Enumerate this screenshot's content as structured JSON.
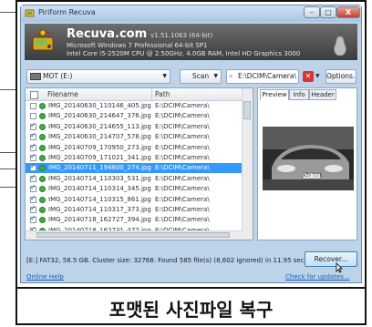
{
  "window": {
    "title": "Piriform Recuva",
    "buttons": {
      "minimize": "–",
      "maximize": "□",
      "close": "X"
    }
  },
  "banner": {
    "brand": "Recuva.com",
    "version": "v1.51.1063 (64-bit)",
    "sysinfo_line1": "Microsoft Windows 7 Professional 64-bit SP1",
    "sysinfo_line2": "Intel Core i5-2520M CPU @ 2.50GHz, 4.0GB RAM, Intel HD Graphics 3000"
  },
  "toolbar": {
    "drive_select": "MOT (E:)",
    "scan_button": "Scan",
    "path_input": "E:\\DCIM\\Camera\\",
    "options_button": "Options..."
  },
  "list": {
    "col_filename": "Filename",
    "col_path": "Path",
    "rows": [
      {
        "name": "IMG_20140630_110146_405.jpg",
        "path": "E:\\DCIM\\Camera\\",
        "checked": false,
        "selected": false
      },
      {
        "name": "IMG_20140630_214647_376.jpg",
        "path": "E:\\DCIM\\Camera\\",
        "checked": false,
        "selected": false
      },
      {
        "name": "IMG_20140630_214655_113.jpg",
        "path": "E:\\DCIM\\Camera\\",
        "checked": true,
        "selected": false
      },
      {
        "name": "IMG_20140630_214707_578.jpg",
        "path": "E:\\DCIM\\Camera\\",
        "checked": true,
        "selected": false
      },
      {
        "name": "IMG_20140709_170950_273.jpg",
        "path": "E:\\DCIM\\Camera\\",
        "checked": true,
        "selected": false
      },
      {
        "name": "IMG_20140709_171021_341.jpg",
        "path": "E:\\DCIM\\Camera\\",
        "checked": true,
        "selected": false
      },
      {
        "name": "IMG_20140711_194800_274.jpg",
        "path": "E:\\DCIM\\Camera\\",
        "checked": true,
        "selected": true
      },
      {
        "name": "IMG_20140714_110303_531.jpg",
        "path": "E:\\DCIM\\Camera\\",
        "checked": true,
        "selected": false
      },
      {
        "name": "IMG_20140714_110314_345.jpg",
        "path": "E:\\DCIM\\Camera\\",
        "checked": true,
        "selected": false
      },
      {
        "name": "IMG_20140714_110315_861.jpg",
        "path": "E:\\DCIM\\Camera\\",
        "checked": true,
        "selected": false
      },
      {
        "name": "IMG_20140714_110317_373.jpg",
        "path": "E:\\DCIM\\Camera\\",
        "checked": true,
        "selected": false
      },
      {
        "name": "IMG_20140718_162727_394.jpg",
        "path": "E:\\DCIM\\Camera\\",
        "checked": true,
        "selected": false
      },
      {
        "name": "IMG_20140718_162731_477.jpg",
        "path": "E:\\DCIM\\Camera\\",
        "checked": true,
        "selected": false
      }
    ]
  },
  "preview": {
    "tabs": [
      "Preview",
      "Info",
      "Header"
    ],
    "active_tab": 0,
    "plate_text": "KZV 7171"
  },
  "status": {
    "text": "[E:] FAT32, 58.5 GB. Cluster size: 32768. Found 585 file(s) (8,602 ignored) in 11.95 sec.",
    "recover_button": "Recover..."
  },
  "footer": {
    "online_help": "Online Help",
    "check_updates": "Check for updates..."
  },
  "caption": {
    "text": "포맷된 사진파일 복구"
  },
  "colors": {
    "selection": "#3399ff",
    "banner": "#4a4a4a",
    "window_frame": "#bcd3ea",
    "close_button": "#c2412e"
  },
  "icons": [
    "drive-icon",
    "pear-logo-icon",
    "search-icon",
    "clear-icon",
    "file-status-icon",
    "cursor-icon"
  ]
}
